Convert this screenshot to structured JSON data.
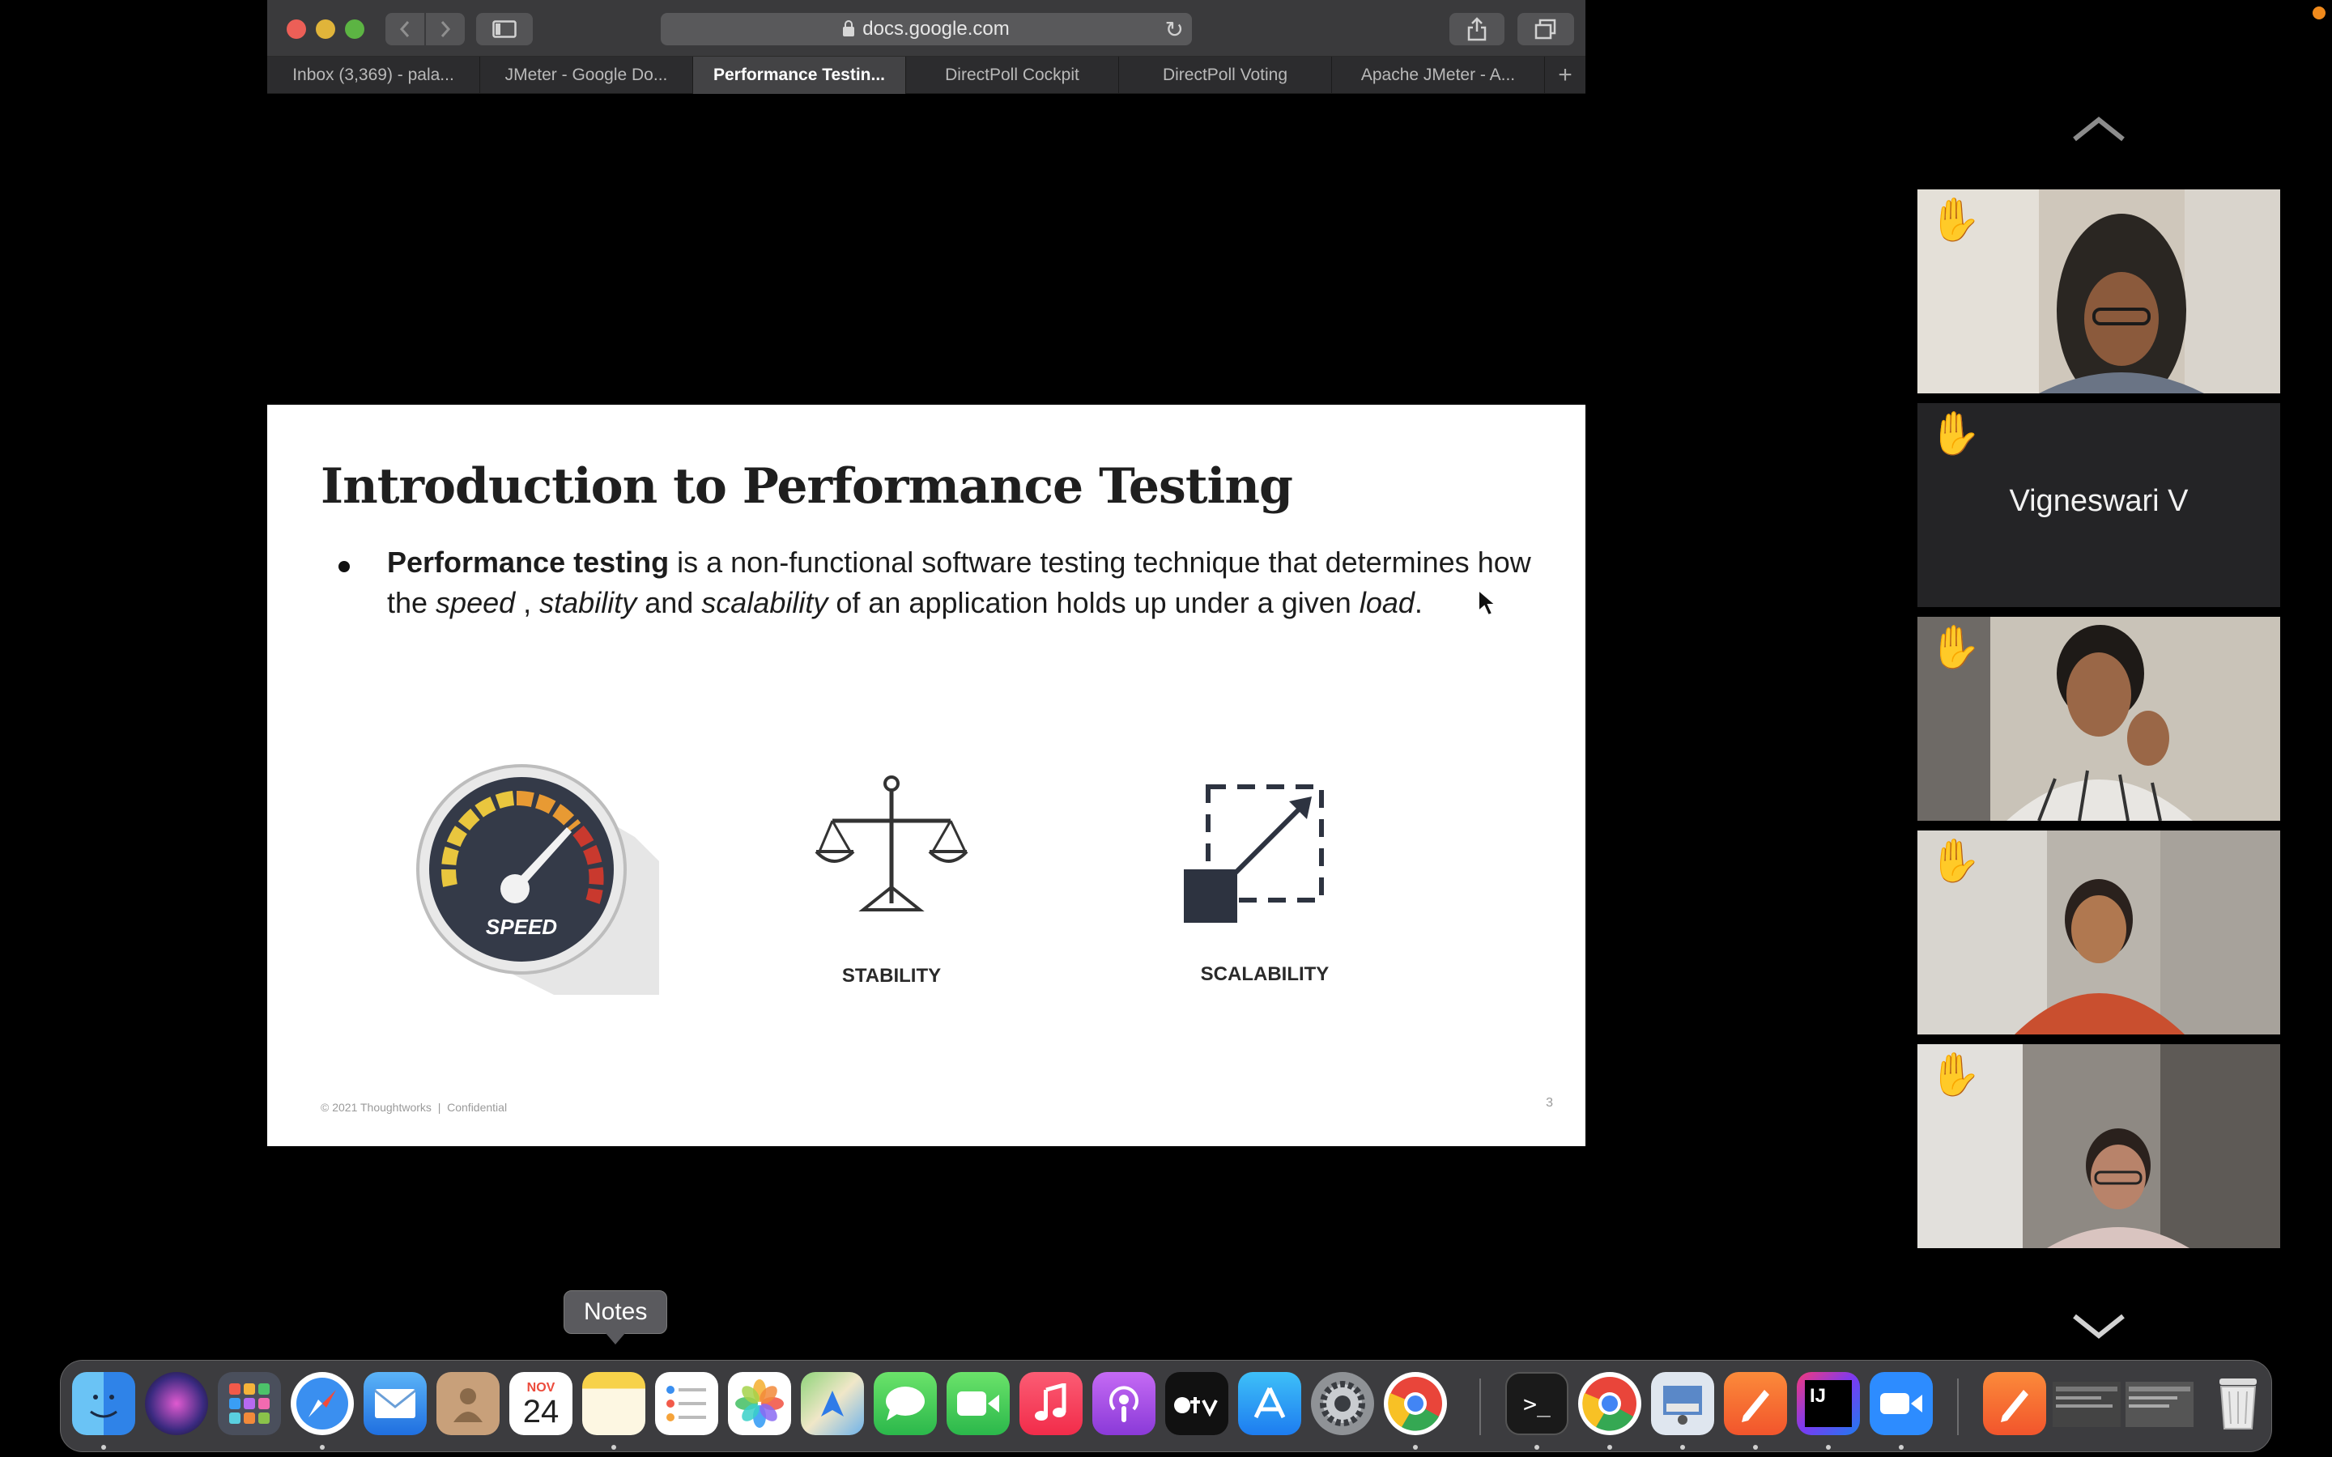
{
  "browser": {
    "url": "docs.google.com",
    "tabs": [
      {
        "label": "Inbox (3,369) - pala..."
      },
      {
        "label": "JMeter - Google Do..."
      },
      {
        "label": "Performance Testin..."
      },
      {
        "label": "DirectPoll Cockpit"
      },
      {
        "label": "DirectPoll Voting"
      },
      {
        "label": "Apache JMeter - A..."
      }
    ],
    "active_tab_index": 2,
    "new_tab_glyph": "+"
  },
  "slide": {
    "title": "Introduction to Performance Testing",
    "bullet": {
      "bold": "Performance testing",
      "t1": " is a non-functional software testing technique that determines how the ",
      "speed": "speed",
      "t2": " , ",
      "stability": "stability",
      "t3": "  and ",
      "scalability": "scalability",
      "t4": " of an application holds up under a given ",
      "load": "load",
      "t5": "."
    },
    "speedometer_text": "SPEED",
    "stability_label": "STABILITY",
    "scalability_label": "SCALABILITY",
    "footer_copyright": "© 2021 Thoughtworks",
    "footer_sep": "|",
    "footer_confidential": "Confidential",
    "page_number": "3"
  },
  "participants": [
    {
      "type": "video",
      "hand_raised": true
    },
    {
      "type": "name",
      "name": "Vigneswari V",
      "hand_raised": true
    },
    {
      "type": "video",
      "hand_raised": true
    },
    {
      "type": "video",
      "hand_raised": true
    },
    {
      "type": "video",
      "hand_raised": true
    }
  ],
  "dock": {
    "tooltip": "Notes",
    "calendar_month": "NOV",
    "calendar_day": "24",
    "apps": [
      "finder-icon",
      "siri-icon",
      "launchpad-icon",
      "safari-icon",
      "mail-icon",
      "contacts-icon",
      "calendar-icon",
      "notes-icon",
      "reminders-icon",
      "photos-icon",
      "maps-icon",
      "messages-icon",
      "facetime-icon",
      "music-icon",
      "podcasts-icon",
      "tv-icon",
      "app-store-icon",
      "system-preferences-icon",
      "chrome-icon",
      "terminal-icon",
      "chrome-beta-icon",
      "preview-icon",
      "sketch-icon",
      "intellij-icon",
      "zoom-icon",
      "pencil-app-icon",
      "minimized-window-icon",
      "trash-icon"
    ]
  },
  "colors": {
    "accent_red": "#ec5f57",
    "accent_yellow": "#e0b43a",
    "accent_green": "#5cb443",
    "hand": "#f6c243",
    "dock_notes_yellow": "#f7d24a"
  }
}
